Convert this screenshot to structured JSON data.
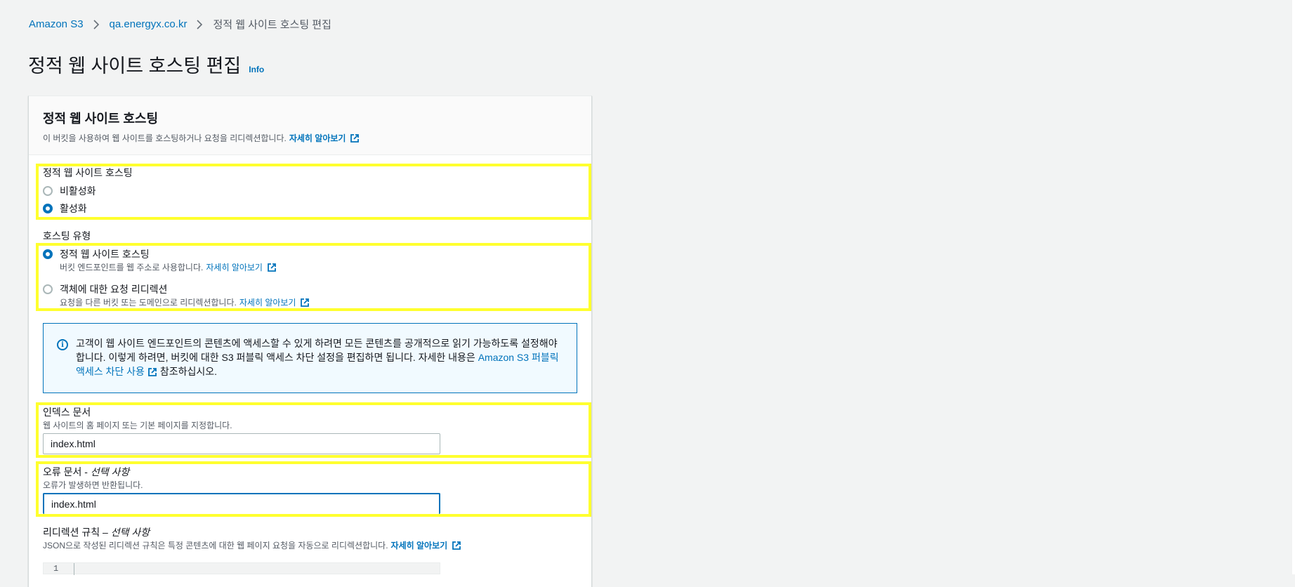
{
  "breadcrumb": {
    "items": [
      "Amazon S3",
      "qa.energyx.co.kr"
    ],
    "current": "정적 웹 사이트 호스팅 편집"
  },
  "page": {
    "title": "정적 웹 사이트 호스팅 편집",
    "info": "Info"
  },
  "panel": {
    "title": "정적 웹 사이트 호스팅",
    "description": "이 버킷을 사용하여 웹 사이트를 호스팅하거나 요청을 리디렉션합니다.",
    "learn_more": "자세히 알아보기"
  },
  "hosting": {
    "label": "정적 웹 사이트 호스팅",
    "options": [
      "비활성화",
      "활성화"
    ],
    "selected": "활성화"
  },
  "hosting_type": {
    "label": "호스팅 유형",
    "option1": {
      "label": "정적 웹 사이트 호스팅",
      "desc": "버킷 엔드포인트를 웹 주소로 사용합니다.",
      "link": "자세히 알아보기"
    },
    "option2": {
      "label": "객체에 대한 요청 리디렉션",
      "desc": "요청을 다른 버킷 또는 도메인으로 리디렉션합니다.",
      "link": "자세히 알아보기"
    },
    "selected": "정적 웹 사이트 호스팅"
  },
  "alert": {
    "text1": "고객이 웹 사이트 엔드포인트의 콘텐츠에 액세스할 수 있게 하려면 모든 콘텐츠를 공개적으로 읽기 가능하도록 설정해야 합니다. 이렇게 하려면, 버킷에 대한 S3 퍼블릭 액세스 차단 설정을 편집하면 됩니다. 자세한 내용은 ",
    "link": "Amazon S3 퍼블릭 액세스 차단 사용",
    "text2": " 참조하십시오."
  },
  "index_document": {
    "label": "인덱스 문서",
    "desc": "웹 사이트의 홈 페이지 또는 기본 페이지를 지정합니다.",
    "value": "index.html"
  },
  "error_document": {
    "label": "오류 문서 - ",
    "optional": "선택 사항",
    "desc": "오류가 발생하면 반환됩니다.",
    "value": "index.html"
  },
  "redirect_rules": {
    "label": "리디렉션 규칙 – ",
    "optional": "선택 사항",
    "desc": "JSON으로 작성된 리디렉션 규칙은 특정 콘텐츠에 대한 웹 페이지 요청을 자동으로 리디렉션합니다.",
    "learn_more": "자세히 알아보기",
    "line_number": "1"
  },
  "colors": {
    "link": "#0073bb",
    "highlight": "#ffff2e",
    "alert_bg": "#f1faff"
  }
}
